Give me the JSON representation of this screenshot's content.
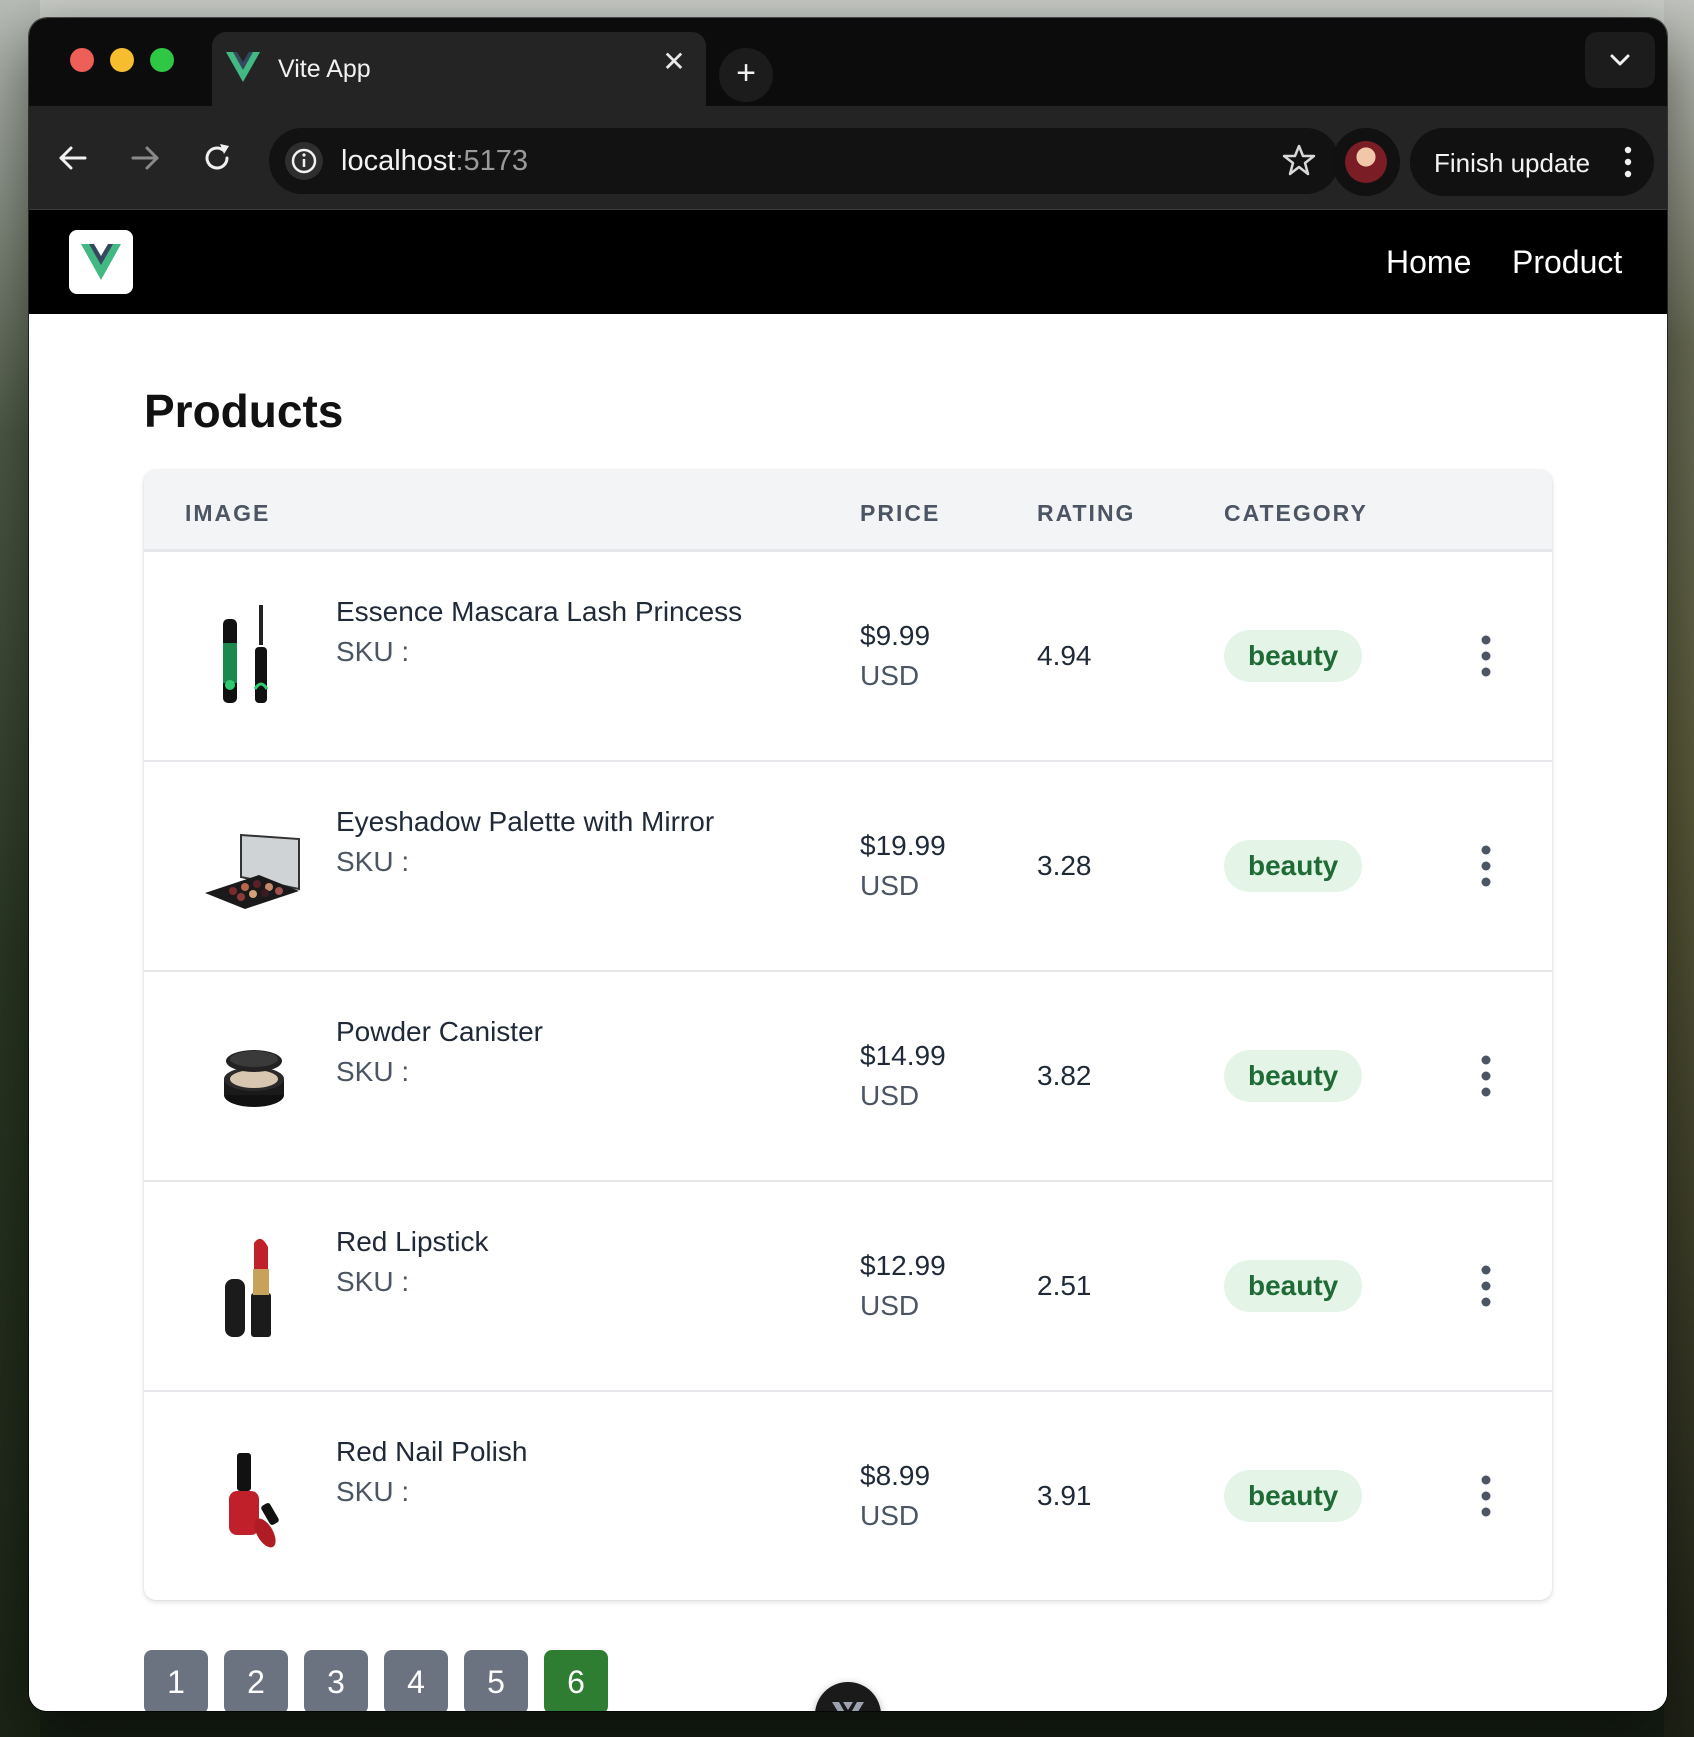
{
  "browser": {
    "tab_title": "Vite App",
    "url_host": "localhost",
    "url_port": ":5173",
    "finish_update_label": "Finish update"
  },
  "app": {
    "nav": [
      {
        "label": "Home"
      },
      {
        "label": "Product"
      }
    ],
    "page_title": "Products",
    "table": {
      "headers": {
        "image": "IMAGE",
        "price": "PRICE",
        "rating": "RATING",
        "category": "CATEGORY"
      },
      "rows": [
        {
          "name": "Essence Mascara Lash Princess",
          "sku": "SKU :",
          "price": "$9.99",
          "currency": "USD",
          "rating": "4.94",
          "category": "beauty",
          "image_icon": "mascara-image"
        },
        {
          "name": "Eyeshadow Palette with Mirror",
          "sku": "SKU :",
          "price": "$19.99",
          "currency": "USD",
          "rating": "3.28",
          "category": "beauty",
          "image_icon": "eyeshadow-palette-image"
        },
        {
          "name": "Powder Canister",
          "sku": "SKU :",
          "price": "$14.99",
          "currency": "USD",
          "rating": "3.82",
          "category": "beauty",
          "image_icon": "powder-canister-image"
        },
        {
          "name": "Red Lipstick",
          "sku": "SKU :",
          "price": "$12.99",
          "currency": "USD",
          "rating": "2.51",
          "category": "beauty",
          "image_icon": "lipstick-image"
        },
        {
          "name": "Red Nail Polish",
          "sku": "SKU :",
          "price": "$8.99",
          "currency": "USD",
          "rating": "3.91",
          "category": "beauty",
          "image_icon": "nail-polish-image"
        }
      ]
    },
    "pagination": {
      "pages": [
        "1",
        "2",
        "3",
        "4",
        "5",
        "6"
      ],
      "current": "6"
    }
  },
  "colors": {
    "vue_green": "#42b883",
    "vue_dark": "#35495e",
    "badge_bg": "#e4f5e8",
    "badge_text": "#1f6b35",
    "page_active": "#2f7d32",
    "page_inactive": "#6b7280"
  }
}
